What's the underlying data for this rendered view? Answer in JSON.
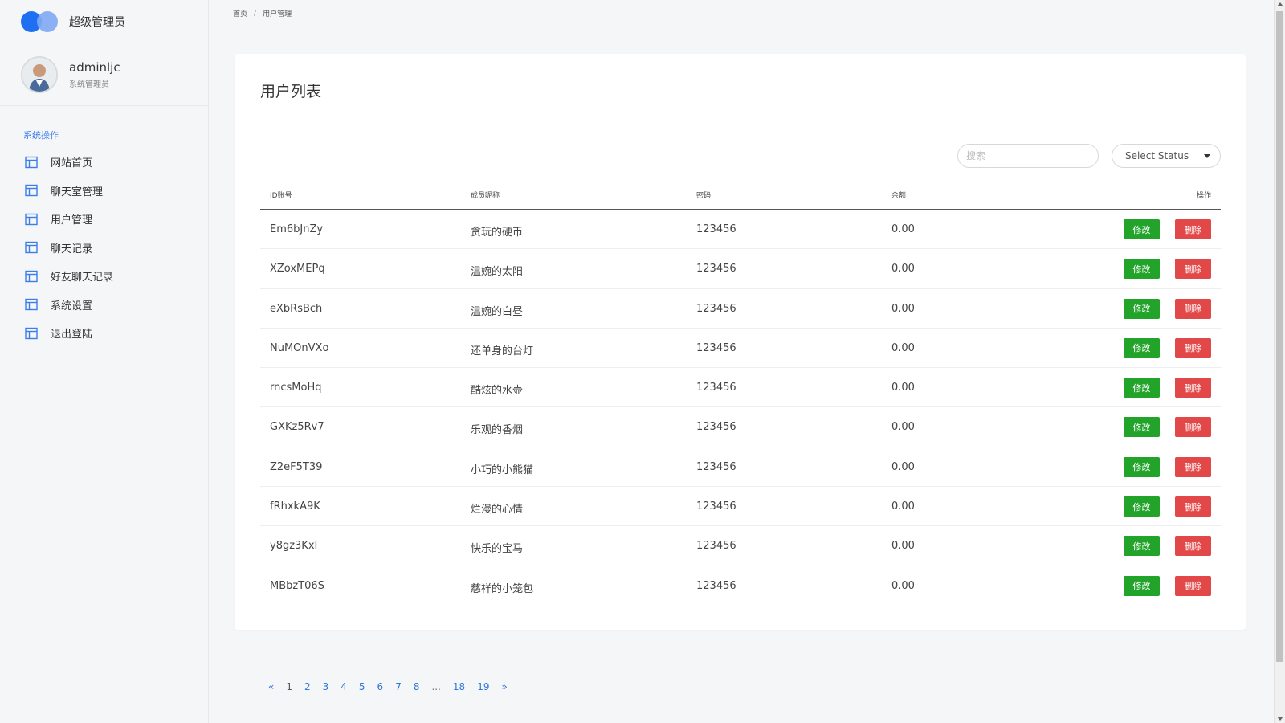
{
  "brand": {
    "title": "超级管理员"
  },
  "profile": {
    "name": "adminljc",
    "role": "系统管理员"
  },
  "sidebar": {
    "section_label": "系统操作",
    "items": [
      {
        "label": "网站首页",
        "icon": "layout-icon"
      },
      {
        "label": "聊天室管理",
        "icon": "layout-icon"
      },
      {
        "label": "用户管理",
        "icon": "layout-icon"
      },
      {
        "label": "聊天记录",
        "icon": "layout-icon"
      },
      {
        "label": "好友聊天记录",
        "icon": "layout-icon"
      },
      {
        "label": "系统设置",
        "icon": "layout-icon"
      },
      {
        "label": "退出登陆",
        "icon": "layout-icon"
      }
    ]
  },
  "breadcrumb": {
    "home": "首页",
    "separator": "/",
    "current": "用户管理"
  },
  "main": {
    "title": "用户列表",
    "search_placeholder": "搜索",
    "status_select": "Select Status"
  },
  "table": {
    "headers": {
      "id": "ID账号",
      "nickname": "成员昵称",
      "password": "密码",
      "balance": "余额",
      "actions": "操作"
    },
    "rows": [
      {
        "id": "Em6bJnZy",
        "nickname": "贪玩的硬币",
        "password": "123456",
        "balance": "0.00"
      },
      {
        "id": "XZoxMEPq",
        "nickname": "温婉的太阳",
        "password": "123456",
        "balance": "0.00"
      },
      {
        "id": "eXbRsBch",
        "nickname": "温婉的白昼",
        "password": "123456",
        "balance": "0.00"
      },
      {
        "id": "NuMOnVXo",
        "nickname": "还单身的台灯",
        "password": "123456",
        "balance": "0.00"
      },
      {
        "id": "rncsMoHq",
        "nickname": "酷炫的水壶",
        "password": "123456",
        "balance": "0.00"
      },
      {
        "id": "GXKz5Rv7",
        "nickname": "乐观的香烟",
        "password": "123456",
        "balance": "0.00"
      },
      {
        "id": "Z2eF5T39",
        "nickname": "小巧的小熊猫",
        "password": "123456",
        "balance": "0.00"
      },
      {
        "id": "fRhxkA9K",
        "nickname": "烂漫的心情",
        "password": "123456",
        "balance": "0.00"
      },
      {
        "id": "y8gz3KxI",
        "nickname": "快乐的宝马",
        "password": "123456",
        "balance": "0.00"
      },
      {
        "id": "MBbzT06S",
        "nickname": "慈祥的小笼包",
        "password": "123456",
        "balance": "0.00"
      }
    ],
    "edit_label": "修改",
    "delete_label": "删除"
  },
  "pagination": {
    "prev": "«",
    "pages": [
      "1",
      "2",
      "3",
      "4",
      "5",
      "6",
      "7",
      "8",
      "...",
      "18",
      "19"
    ],
    "current": "1",
    "next": "»"
  },
  "colors": {
    "accent": "#3b7de9",
    "edit_button": "#22a32a",
    "delete_button": "#e24848"
  }
}
